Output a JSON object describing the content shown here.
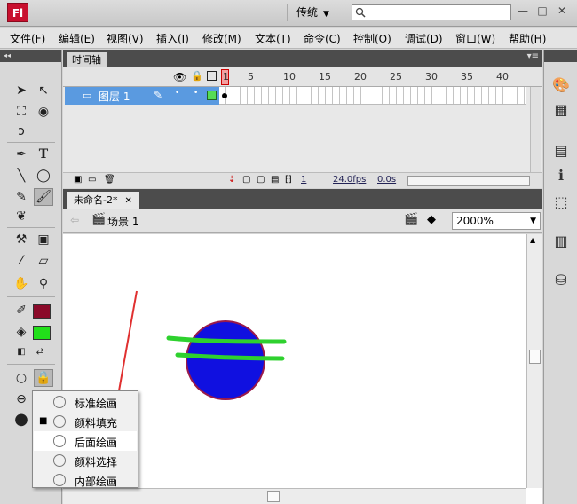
{
  "app": {
    "logo": "Fl",
    "workspace": "传统",
    "search_placeholder": ""
  },
  "window_buttons": [
    "—",
    "□",
    "✕"
  ],
  "menu": [
    "文件(F)",
    "编辑(E)",
    "视图(V)",
    "插入(I)",
    "修改(M)",
    "文本(T)",
    "命令(C)",
    "控制(O)",
    "调试(D)",
    "窗口(W)",
    "帮助(H)"
  ],
  "timeline": {
    "tab": "时间轴",
    "frame_numbers": [
      "1",
      "5",
      "10",
      "15",
      "20",
      "25",
      "30",
      "35",
      "40"
    ],
    "layer_name": "图层 1",
    "fps": "24.0fps",
    "time": "0.0s",
    "current_frame": "1"
  },
  "document": {
    "tab": "未命名-2*",
    "close": "✕",
    "scene": "场景 1",
    "zoom": "2000%"
  },
  "colors": {
    "stroke": "#8b0a2a",
    "fill": "#22e01a",
    "circle_fill": "#1010e0",
    "circle_stroke": "#9a1a4a",
    "green_lines": "#2ed12e",
    "arrow": "#e03030"
  },
  "popup": {
    "items": [
      {
        "label": "标准绘画",
        "icon": "paint-normal-icon",
        "checked": false,
        "highlighted": false
      },
      {
        "label": "颜料填充",
        "icon": "paint-fills-icon",
        "checked": true,
        "highlighted": false
      },
      {
        "label": "后面绘画",
        "icon": "paint-behind-icon",
        "checked": false,
        "highlighted": true
      },
      {
        "label": "颜料选择",
        "icon": "paint-selection-icon",
        "checked": false,
        "highlighted": false
      },
      {
        "label": "内部绘画",
        "icon": "paint-inside-icon",
        "checked": false,
        "highlighted": false
      }
    ]
  }
}
